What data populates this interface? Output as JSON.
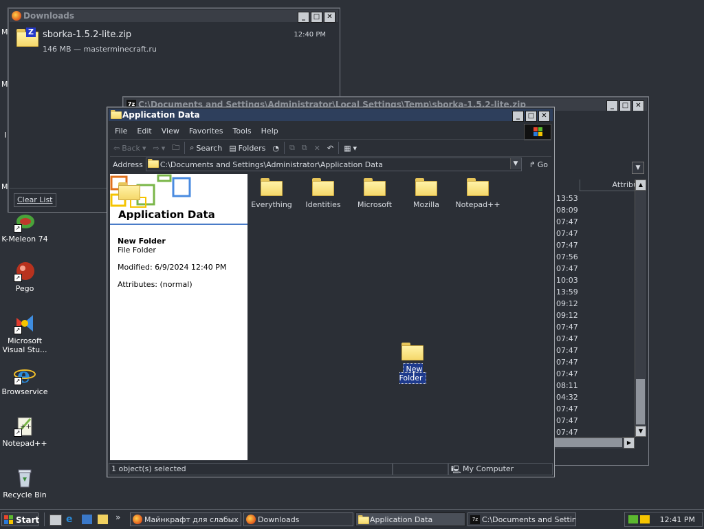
{
  "desktop": {
    "icons": [
      {
        "label": "K-Meleon 74"
      },
      {
        "label": "Pego"
      },
      {
        "label": "Microsoft Visual Stu..."
      },
      {
        "label": "Browservice"
      },
      {
        "label": "Notepad++"
      },
      {
        "label": "Recycle Bin"
      }
    ],
    "side_letters": [
      "M",
      "M",
      "I",
      "M"
    ]
  },
  "downloads": {
    "title": "Downloads",
    "item_name": "sborka-1.5.2-lite.zip",
    "item_time": "12:40 PM",
    "item_detail": "146 MB — masterminecraft.ru",
    "clear_list": "Clear List",
    "zip_letter": "Z"
  },
  "bg_window": {
    "title": "C:\\Documents and Settings\\Administrator\\Local Settings\\Temp\\sborka-1.5.2-lite.zip",
    "column_header": "Attribu",
    "times": [
      "13:53",
      "08:09",
      "07:47",
      "07:47",
      "07:47",
      "07:56",
      "07:47",
      "10:03",
      "13:59",
      "09:12",
      "09:12",
      "07:47",
      "07:47",
      "07:47",
      "07:47",
      "07:47",
      "08:11",
      "04:32",
      "07:47",
      "07:47",
      "07:47"
    ]
  },
  "explorer": {
    "title": "Application Data",
    "menu": [
      "File",
      "Edit",
      "View",
      "Favorites",
      "Tools",
      "Help"
    ],
    "toolbar": {
      "back": "Back",
      "search": "Search",
      "folders": "Folders"
    },
    "address_label": "Address",
    "address_value": "C:\\Documents and Settings\\Administrator\\Application Data",
    "go_label": "Go",
    "left_panel": {
      "heading": "Application Data",
      "selected_name": "New Folder",
      "selected_type": "File Folder",
      "modified": "Modified: 6/9/2024 12:40 PM",
      "attributes": "Attributes: (normal)"
    },
    "folders": [
      "Everything",
      "Identities",
      "Microsoft",
      "Mozilla",
      "Notepad++"
    ],
    "new_folder": "New Folder",
    "status_left": "1 object(s) selected",
    "status_right": "My Computer"
  },
  "taskbar": {
    "start": "Start",
    "items": [
      {
        "label": "Майнкрафт для слабых ..."
      },
      {
        "label": "Downloads"
      },
      {
        "label": "Application Data"
      },
      {
        "label": "C:\\Documents and Settin..."
      }
    ],
    "chevron": "»",
    "clock": "12:41 PM"
  }
}
